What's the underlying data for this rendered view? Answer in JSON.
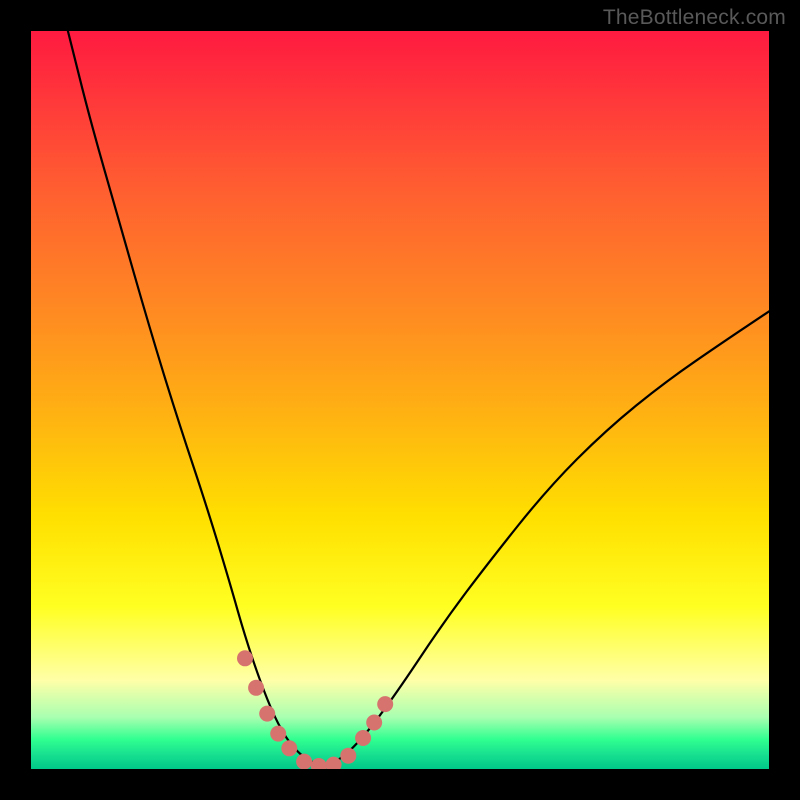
{
  "watermark": "TheBottleneck.com",
  "chart_data": {
    "type": "line",
    "title": "",
    "xlabel": "",
    "ylabel": "",
    "xlim": [
      0,
      100
    ],
    "ylim": [
      0,
      100
    ],
    "legend": false,
    "grid": false,
    "background_gradient": {
      "top": "#ff1a40",
      "upper_mid": "#ff8a22",
      "mid": "#ffe000",
      "lower_mid": "#ffff88",
      "bottom": "#00c888"
    },
    "series": [
      {
        "name": "bottleneck-curve",
        "color": "#000000",
        "stroke_width": 2,
        "x": [
          5,
          8,
          12,
          16,
          20,
          24,
          27,
          29,
          31,
          33,
          35,
          37,
          39,
          41,
          43,
          46,
          50,
          56,
          62,
          70,
          78,
          86,
          94,
          100
        ],
        "y": [
          100,
          88,
          74,
          60,
          47,
          35,
          25,
          18,
          12,
          7,
          3.5,
          1.5,
          0.5,
          0.8,
          2.2,
          5.5,
          11,
          20,
          28,
          38,
          46,
          52.5,
          58,
          62
        ]
      },
      {
        "name": "highlight-dots",
        "color": "#d6736e",
        "marker": "circle",
        "marker_size": 12,
        "x": [
          29.0,
          30.5,
          32.0,
          33.5,
          35.0,
          37.0,
          39.0,
          41.0,
          43.0,
          45.0,
          46.5,
          48.0
        ],
        "y": [
          15.0,
          11.0,
          7.5,
          4.8,
          2.8,
          1.0,
          0.4,
          0.6,
          1.8,
          4.2,
          6.3,
          8.8
        ]
      }
    ]
  }
}
